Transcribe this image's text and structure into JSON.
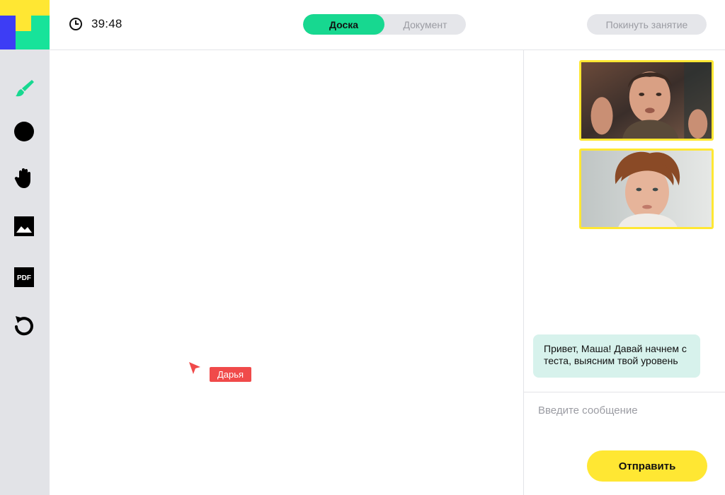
{
  "header": {
    "timer": "39:48",
    "tabs": [
      {
        "label": "Доска",
        "active": true
      },
      {
        "label": "Документ",
        "active": false
      }
    ],
    "leave_label": "Покинуть занятие"
  },
  "toolbar": {
    "tools": [
      "brush-icon",
      "circle-icon",
      "hand-icon",
      "image-icon",
      "pdf-icon",
      "undo-icon"
    ],
    "pdf_label": "PDF"
  },
  "board": {
    "cursor_user": "Дарья"
  },
  "chat": {
    "messages": [
      {
        "text": "Привет, Маша! Давай начнем с теста, выясним твой уровень"
      }
    ],
    "input_placeholder": "Введите сообщение",
    "send_label": "Отправить"
  },
  "colors": {
    "accent_green": "#17d890",
    "accent_yellow": "#ffe733",
    "logo_blue": "#3d3df5",
    "cursor_red": "#f04a4a",
    "bubble_bg": "#d7f2ec"
  }
}
